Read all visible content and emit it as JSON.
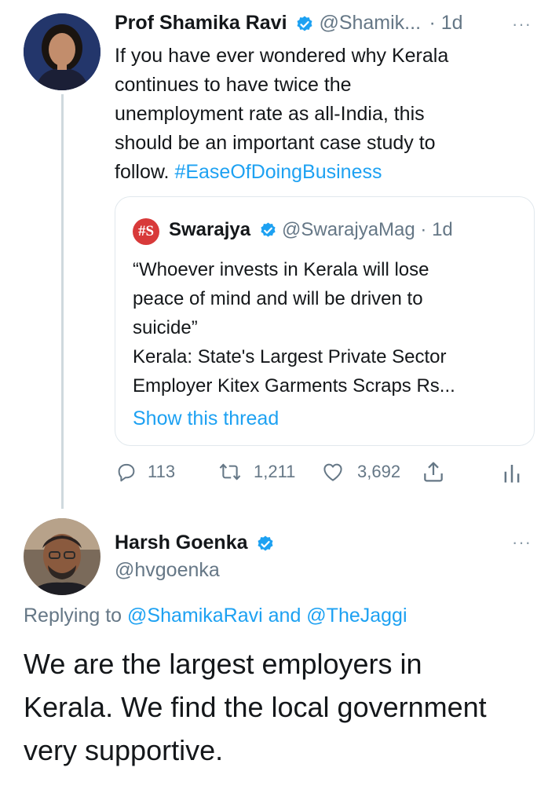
{
  "tweet1": {
    "display_name": "Prof Shamika Ravi",
    "handle": "@Shamik...",
    "time": "· 1d",
    "more": "···",
    "text_lines": [
      "If you have ever wondered why Kerala",
      "continues to have twice the",
      "unemployment rate as all-India, this",
      "should be an important case study to"
    ],
    "text_last_prefix": "follow. ",
    "hashtag": "#EaseOfDoingBusiness",
    "quote": {
      "logo_text": "#S",
      "name": "Swarajya",
      "handle_time": "@SwarajyaMag · 1d",
      "lines": [
        "“Whoever invests in Kerala will lose",
        "peace of mind and will be driven to",
        "suicide”",
        "Kerala: State's Largest Private Sector",
        "Employer Kitex Garments Scraps Rs..."
      ],
      "show_thread": "Show this thread"
    },
    "actions": {
      "replies": "113",
      "retweets": "1,211",
      "likes": "3,692"
    }
  },
  "tweet2": {
    "display_name": "Harsh Goenka",
    "handle": "@hvgoenka",
    "more": "···",
    "replying_prefix": "Replying to ",
    "replying_user1": "@ShamikaRavi",
    "replying_and": " and ",
    "replying_user2": "@TheJaggi",
    "text_lines": [
      "We are the largest employers in",
      "Kerala. We find the local government",
      "very supportive."
    ]
  },
  "colors": {
    "accent": "#1da1f2",
    "muted": "#657786",
    "verified": "#1da1f2",
    "swarajya_red": "#d83a3a"
  }
}
